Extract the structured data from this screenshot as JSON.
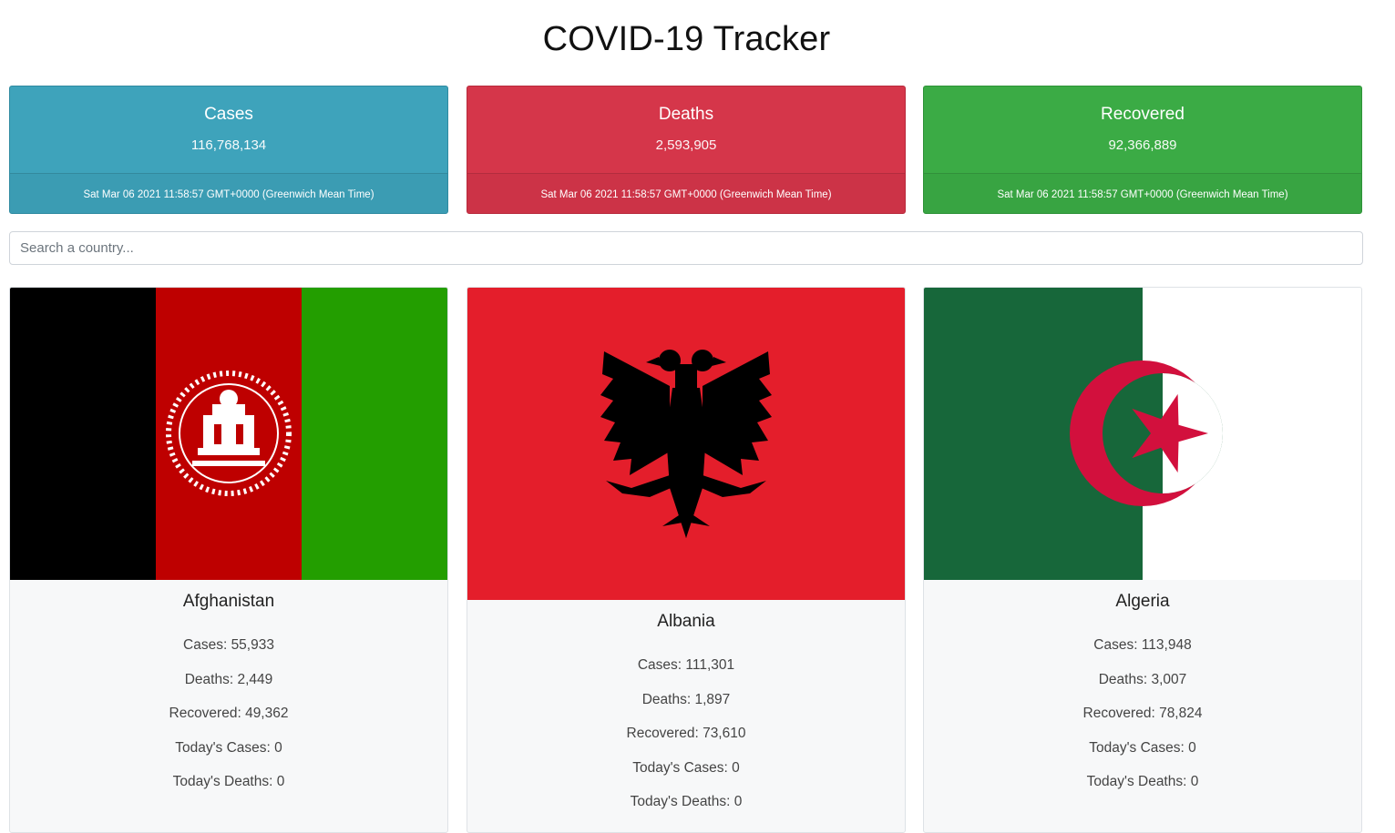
{
  "page": {
    "title": "COVID-19 Tracker"
  },
  "summary": {
    "timestamp": "Sat Mar 06 2021 11:58:57 GMT+0000 (Greenwich Mean Time)",
    "cases": {
      "label": "Cases",
      "value": "116,768,134",
      "color": "#3ea3bb"
    },
    "deaths": {
      "label": "Deaths",
      "value": "2,593,905",
      "color": "#d5364a"
    },
    "recovered": {
      "label": "Recovered",
      "value": "92,366,889",
      "color": "#3bab45"
    }
  },
  "search": {
    "placeholder": "Search a country..."
  },
  "countries": [
    {
      "name": "Afghanistan",
      "flag_icon": "afghanistan-flag-icon",
      "cases": "Cases: 55,933",
      "deaths": "Deaths: 2,449",
      "recovered": "Recovered: 49,362",
      "today_cases": "Today's Cases: 0",
      "today_deaths": "Today's Deaths: 0"
    },
    {
      "name": "Albania",
      "flag_icon": "albania-flag-icon",
      "cases": "Cases: 111,301",
      "deaths": "Deaths: 1,897",
      "recovered": "Recovered: 73,610",
      "today_cases": "Today's Cases: 0",
      "today_deaths": "Today's Deaths: 0"
    },
    {
      "name": "Algeria",
      "flag_icon": "algeria-flag-icon",
      "cases": "Cases: 113,948",
      "deaths": "Deaths: 3,007",
      "recovered": "Recovered: 78,824",
      "today_cases": "Today's Cases: 0",
      "today_deaths": "Today's Deaths: 0"
    }
  ]
}
